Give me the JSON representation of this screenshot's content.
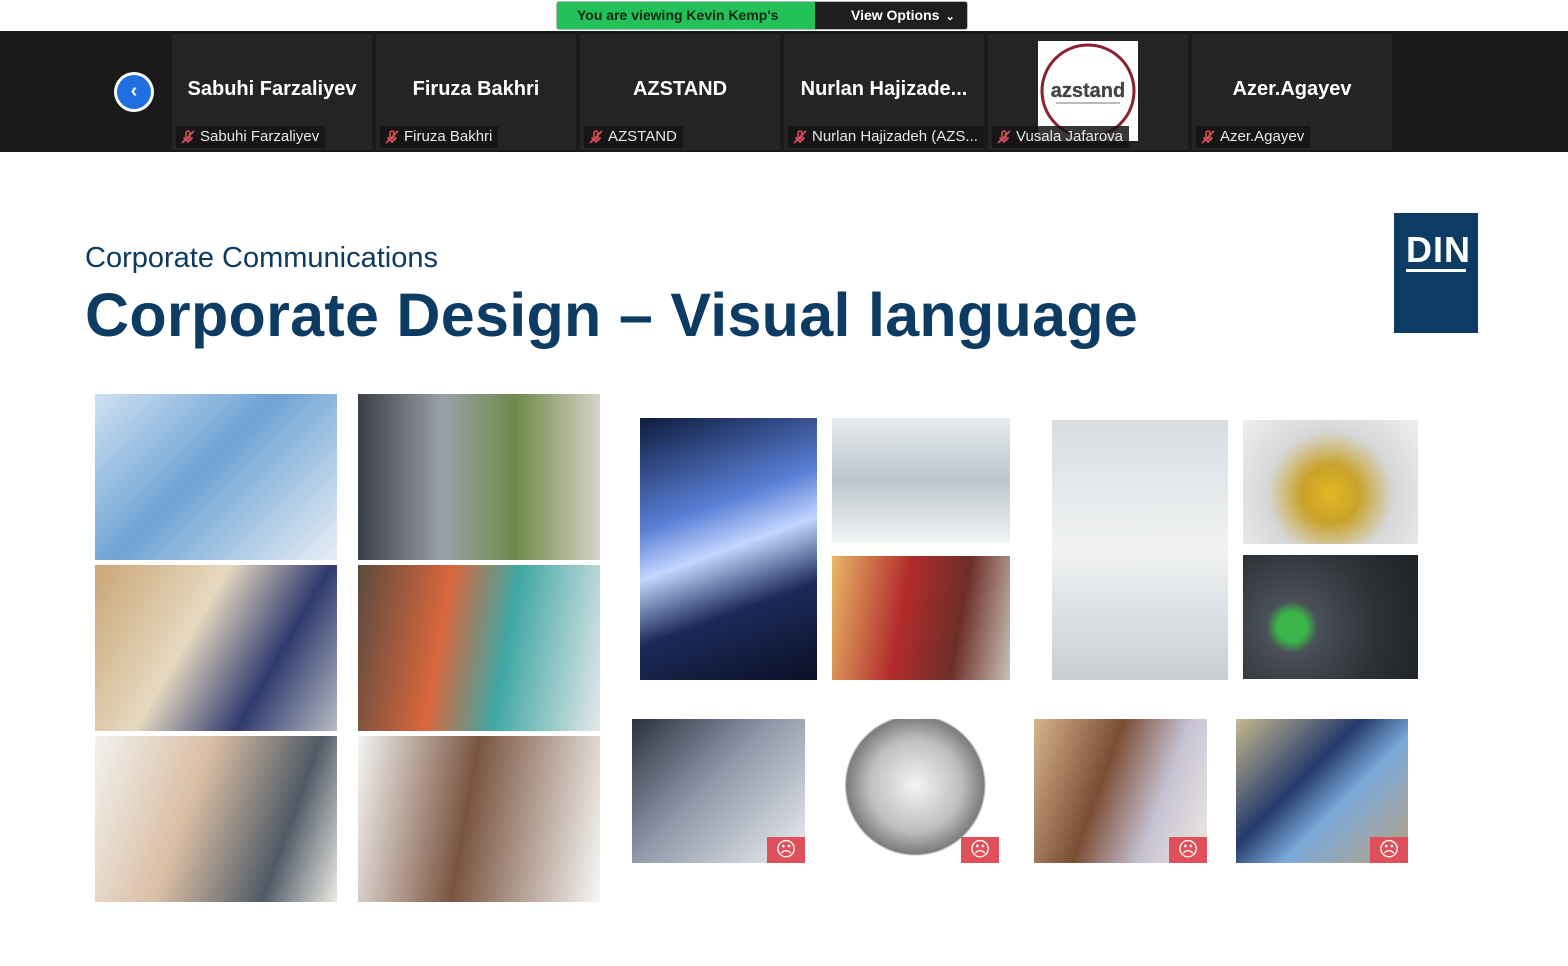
{
  "share_banner": {
    "status": "You are viewing Kevin Kemp's screen",
    "view_options": "View Options"
  },
  "participants": [
    {
      "display": "Sabuhi Farzaliyev",
      "label": "Sabuhi Farzaliyev"
    },
    {
      "display": "Firuza Bakhri",
      "label": "Firuza Bakhri"
    },
    {
      "display": "AZSTAND",
      "label": "AZSTAND"
    },
    {
      "display": "Nurlan  Hajizade...",
      "label": "Nurlan Hajizadeh (AZS..."
    },
    {
      "display": "",
      "label": "Vusala Jafarova",
      "logo": "azstand"
    },
    {
      "display": "Azer.Agayev",
      "label": "Azer.Agayev"
    }
  ],
  "slide": {
    "subtitle": "Corporate Communications",
    "title": "Corporate Design – Visual language",
    "logo": "DIN"
  },
  "colors": {
    "brand_navy": "#0c3b63",
    "share_green": "#24c05a",
    "sad_badge": "#e0505a"
  }
}
